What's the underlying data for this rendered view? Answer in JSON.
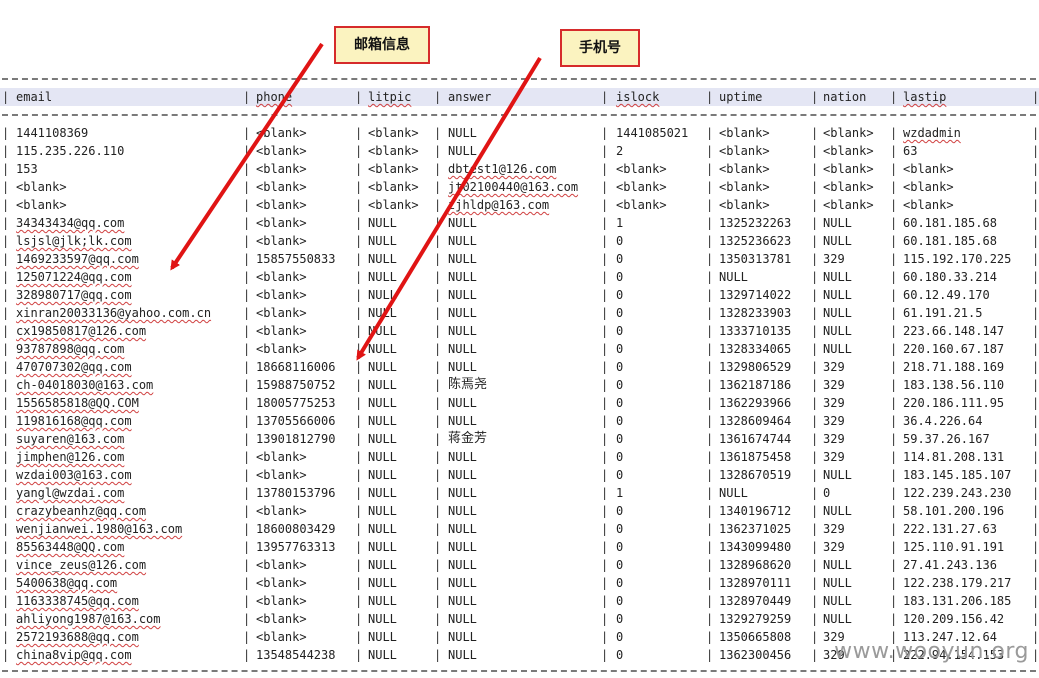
{
  "callouts": {
    "email_label": "邮箱信息",
    "phone_label": "手机号"
  },
  "columns": [
    "email",
    "phone",
    "litpic",
    "answer",
    "islock",
    "uptime",
    "nation",
    "lastip"
  ],
  "rows": [
    [
      "1441108369",
      "<blank>",
      "<blank>",
      "NULL",
      "1441085021",
      "<blank>",
      "<blank>",
      "wzdadmin"
    ],
    [
      "115.235.226.110",
      "<blank>",
      "<blank>",
      "NULL",
      "2",
      "<blank>",
      "<blank>",
      "63"
    ],
    [
      "153",
      "<blank>",
      "<blank>",
      "dbtest1@126.com",
      "<blank>",
      "<blank>",
      "<blank>",
      "<blank>"
    ],
    [
      "<blank>",
      "<blank>",
      "<blank>",
      "jt02100440@163.com",
      "<blank>",
      "<blank>",
      "<blank>",
      "<blank>"
    ],
    [
      "<blank>",
      "<blank>",
      "<blank>",
      "zjhldp@163.com",
      "<blank>",
      "<blank>",
      "<blank>",
      "<blank>"
    ],
    [
      "34343434@qq.com",
      "<blank>",
      "NULL",
      "NULL",
      "1",
      "1325232263",
      "NULL",
      "60.181.185.68"
    ],
    [
      "lsjsl@jlk;lk.com",
      "<blank>",
      "NULL",
      "NULL",
      "0",
      "1325236623",
      "NULL",
      "60.181.185.68"
    ],
    [
      "1469233597@qq.com",
      "15857550833",
      "NULL",
      "NULL",
      "0",
      "1350313781",
      "329",
      "115.192.170.225"
    ],
    [
      "125071224@qq.com",
      "<blank>",
      "NULL",
      "NULL",
      "0",
      "NULL",
      "NULL",
      "60.180.33.214"
    ],
    [
      "328980717@qq.com",
      "<blank>",
      "NULL",
      "NULL",
      "0",
      "1329714022",
      "NULL",
      "60.12.49.170"
    ],
    [
      "xinran20033136@yahoo.com.cn",
      "<blank>",
      "NULL",
      "NULL",
      "0",
      "1328233903",
      "NULL",
      "61.191.21.5"
    ],
    [
      "cx19850817@126.com",
      "<blank>",
      "NULL",
      "NULL",
      "0",
      "1333710135",
      "NULL",
      "223.66.148.147"
    ],
    [
      "93787898@qq.com",
      "<blank>",
      "NULL",
      "NULL",
      "0",
      "1328334065",
      "NULL",
      "220.160.67.187"
    ],
    [
      "470707302@qq.com",
      "18668116006",
      "NULL",
      "NULL",
      "0",
      "1329806529",
      "329",
      "218.71.188.169"
    ],
    [
      "ch-04018030@163.com",
      "15988750752",
      "NULL",
      "陈焉尧",
      "0",
      "1362187186",
      "329",
      "183.138.56.110"
    ],
    [
      "1556585818@QQ.COM",
      "18005775253",
      "NULL",
      "NULL",
      "0",
      "1362293966",
      "329",
      "220.186.111.95"
    ],
    [
      "119816168@qq.com",
      "13705566006",
      "NULL",
      "NULL",
      "0",
      "1328609464",
      "329",
      "36.4.226.64"
    ],
    [
      "suyaren@163.com",
      "13901812790",
      "NULL",
      "蒋金芳",
      "0",
      "1361674744",
      "329",
      "59.37.26.167"
    ],
    [
      "jimphen@126.com",
      "<blank>",
      "NULL",
      "NULL",
      "0",
      "1361875458",
      "329",
      "114.81.208.131"
    ],
    [
      "wzdai003@163.com",
      "<blank>",
      "NULL",
      "NULL",
      "0",
      "1328670519",
      "NULL",
      "183.145.185.107"
    ],
    [
      "yangl@wzdai.com",
      "13780153796",
      "NULL",
      "NULL",
      "1",
      "NULL",
      "0",
      "122.239.243.230"
    ],
    [
      "crazybeanhz@qq.com",
      "<blank>",
      "NULL",
      "NULL",
      "0",
      "1340196712",
      "NULL",
      "58.101.200.196"
    ],
    [
      "wenjianwei.1980@163.com",
      "18600803429",
      "NULL",
      "NULL",
      "0",
      "1362371025",
      "329",
      "222.131.27.63"
    ],
    [
      "85563448@QQ.com",
      "13957763313",
      "NULL",
      "NULL",
      "0",
      "1343099480",
      "329",
      "125.110.91.191"
    ],
    [
      "vince_zeus@126.com",
      "<blank>",
      "NULL",
      "NULL",
      "0",
      "1328968620",
      "NULL",
      "27.41.243.136"
    ],
    [
      "5400638@qq.com",
      "<blank>",
      "NULL",
      "NULL",
      "0",
      "1328970111",
      "NULL",
      "122.238.179.217"
    ],
    [
      "1163338745@qq.com",
      "<blank>",
      "NULL",
      "NULL",
      "0",
      "1328970449",
      "NULL",
      "183.131.206.185"
    ],
    [
      "ahliyong1987@163.com",
      "<blank>",
      "NULL",
      "NULL",
      "0",
      "1329279259",
      "NULL",
      "120.209.156.42"
    ],
    [
      "2572193688@qq.com",
      "<blank>",
      "NULL",
      "NULL",
      "0",
      "1350665808",
      "329",
      "113.247.12.64"
    ],
    [
      "china8vip@qq.com",
      "13548544238",
      "NULL",
      "NULL",
      "0",
      "1362300456",
      "329",
      "222.94.154.153"
    ]
  ],
  "watermark": "www.wooyun.org",
  "colors": {
    "callout_border": "#d62b2b",
    "callout_bg": "#fbf3c0",
    "arrow": "#e01414",
    "header_bg": "#e4e6f4"
  }
}
